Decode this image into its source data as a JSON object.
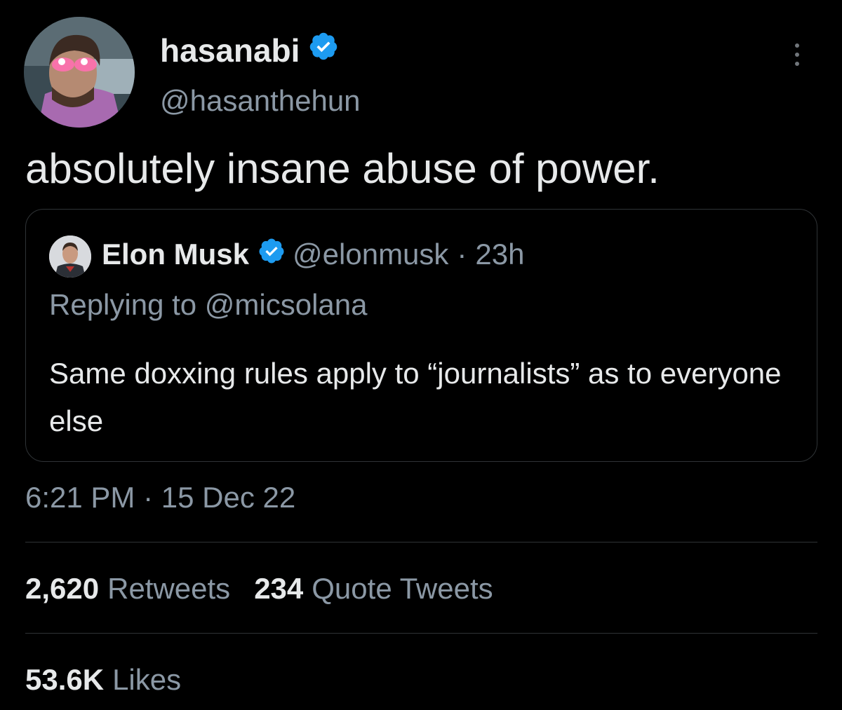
{
  "tweet": {
    "author": {
      "display_name": "hasanabi",
      "handle": "@hasanthehun",
      "verified": true
    },
    "text": "absolutely insane abuse of power.",
    "timestamp": "6:21 PM · 15 Dec 22"
  },
  "quoted_tweet": {
    "display_name": "Elon Musk",
    "handle": "@elonmusk",
    "separator": "·",
    "age": "23h",
    "replying_to": "Replying to @micsolana",
    "text": "Same doxxing rules apply to “journalists” as to everyone else"
  },
  "stats": {
    "retweets": {
      "count": "2,620",
      "label": "Retweets"
    },
    "quote_tweets": {
      "count": "234",
      "label": "Quote Tweets"
    },
    "likes": {
      "count": "53.6K",
      "label": "Likes"
    }
  },
  "colors": {
    "background": "#000000",
    "primary_text": "#e7e9ea",
    "secondary_text": "#8b98a5",
    "border": "#2f3336",
    "verified_blue": "#1d9bf0"
  },
  "icons": {
    "verified": "verified-badge-icon",
    "more": "more-options-icon"
  }
}
